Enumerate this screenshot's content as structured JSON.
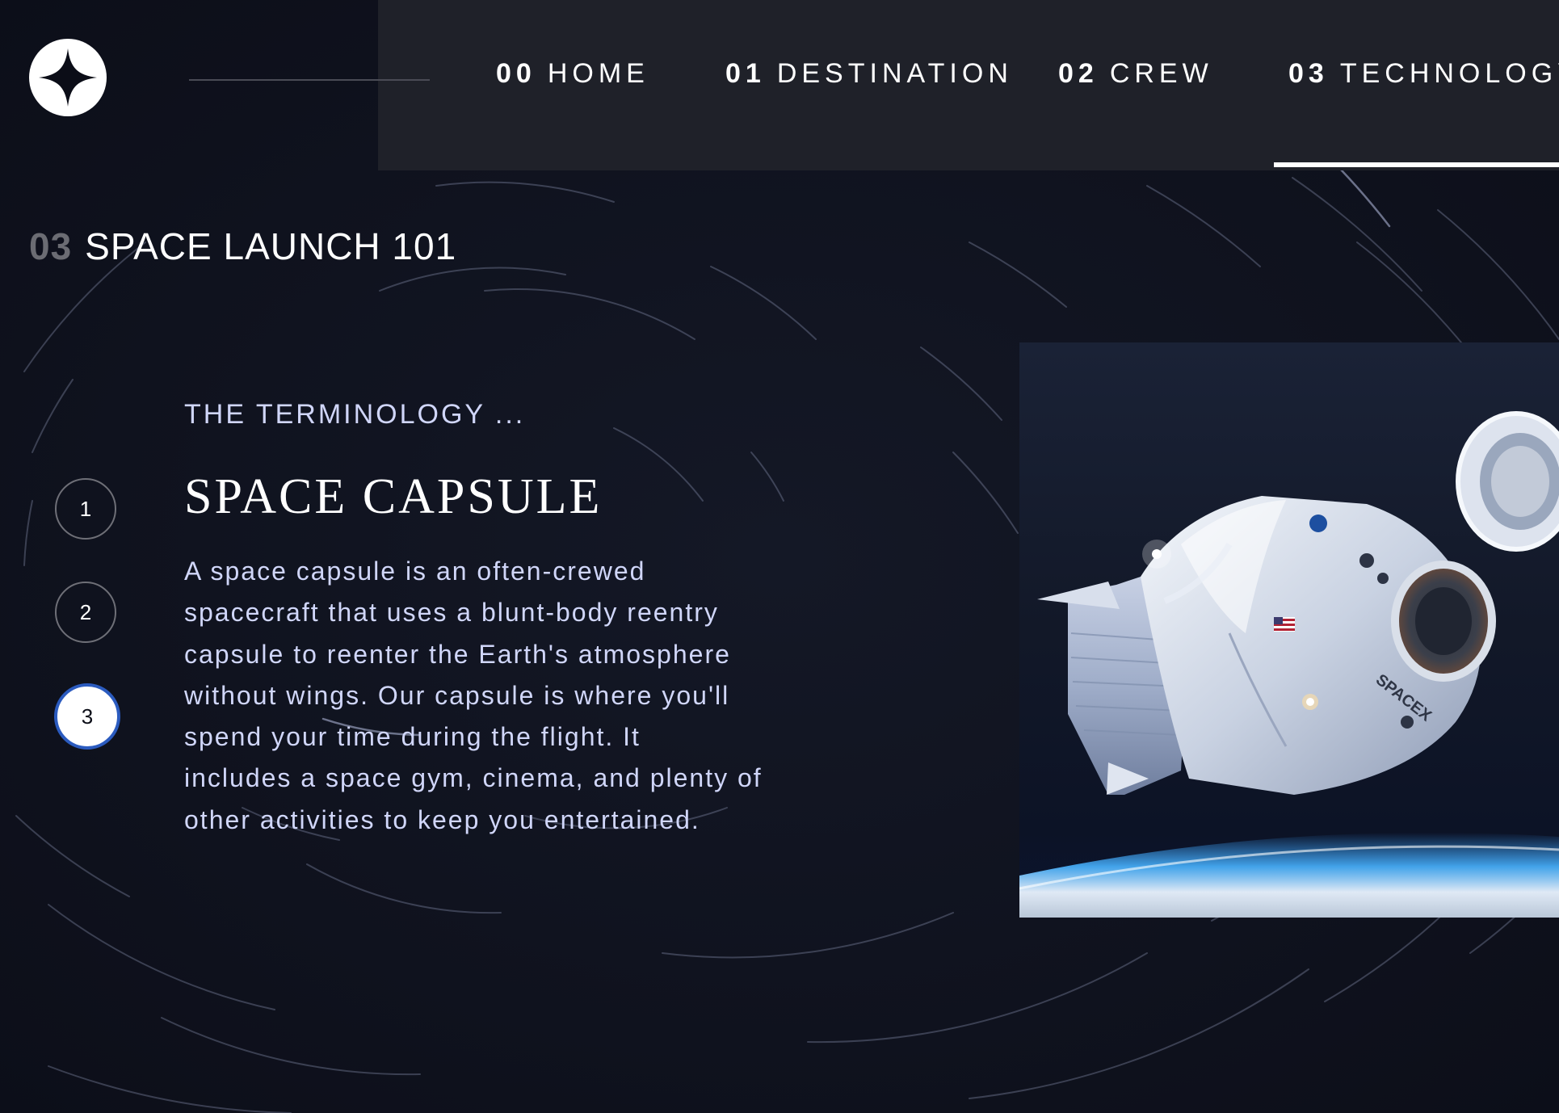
{
  "nav": {
    "items": [
      {
        "num": "00",
        "label": "HOME"
      },
      {
        "num": "01",
        "label": "DESTINATION"
      },
      {
        "num": "02",
        "label": "CREW"
      },
      {
        "num": "03",
        "label": "TECHNOLOGY",
        "active": true
      }
    ]
  },
  "heading": {
    "num": "03",
    "text": "SPACE LAUNCH 101"
  },
  "steps": [
    {
      "label": "1"
    },
    {
      "label": "2"
    },
    {
      "label": "3",
      "active": true
    }
  ],
  "content": {
    "subheading": "THE TERMINOLOGY ...",
    "title": "SPACE CAPSULE",
    "body_lines": [
      "A space capsule is an often-crewed",
      "spacecraft that uses a blunt-body reentry",
      "capsule to reenter the Earth's atmosphere",
      "without wings. Our capsule is where you'll",
      "spend your time during the flight. It",
      "includes a space gym, cinema, and plenty of",
      "other activities to keep you entertained."
    ]
  },
  "image": {
    "flag": "flag-icon",
    "brand_text": "SPACEX"
  },
  "colors": {
    "background": "#0b0d17",
    "nav_panel": "#1f2129",
    "text_light": "#d0d6f9",
    "accent_ring": "#2b5bbf",
    "muted": "#6b6c73"
  }
}
